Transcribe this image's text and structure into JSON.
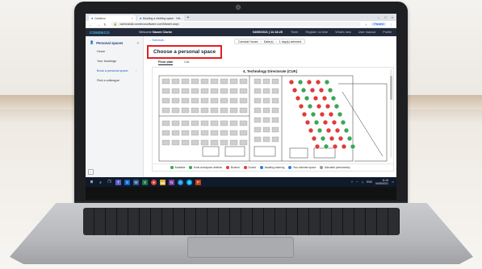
{
  "browser": {
    "tabs": [
      {
        "label": "Condeco"
      },
      {
        "label": "Booking a meeting space · Hel..."
      }
    ],
    "new_tab": "+",
    "url": "carnivalukl.condecosoftware.com/Master.aspx",
    "paused_label": "Paused"
  },
  "app": {
    "logo": "CONDECO",
    "welcome_prefix": "Welcome",
    "user_name": "Naomi Clarke",
    "datetime": "04/05/2021 | 11:18:25",
    "nav_links": [
      "Timer",
      "Register on time",
      "What's new",
      "User manual",
      "Profile"
    ]
  },
  "sidebar": {
    "heading": "Personal spaces",
    "items": [
      {
        "label": "Home"
      },
      {
        "label": "Your bookings"
      },
      {
        "label": "Book a personal space"
      },
      {
        "label": "Find a colleague"
      }
    ]
  },
  "main": {
    "top_link": "← Schedule...",
    "filter": {
      "location": "Carnival House",
      "sep1": "›",
      "dates": "Date(s)",
      "sep2": "›",
      "selected": "1 day(s) selected"
    },
    "page_title": "Choose a personal space",
    "view_tabs": [
      "Floor plan",
      "List"
    ],
    "floor_title": "4, Technology Directorate (CUK)",
    "legend": [
      {
        "label": "Available",
        "color": "#3aa655"
      },
      {
        "label": "Ends workspace deletion",
        "color": "#3aa655"
      },
      {
        "label": "Booked",
        "color": "#e03a3a"
      },
      {
        "label": "Closed",
        "color": "#e03a3a"
      },
      {
        "label": "Awaiting cleaning",
        "color": "#2b7de0"
      },
      {
        "label": "Your selected space",
        "color": "#2b7de0"
      },
      {
        "label": "Allocated permanently",
        "color": "#999999"
      }
    ]
  },
  "taskbar": {
    "tray_lang": "ENG",
    "time": "11:18",
    "date": "04/05/2021"
  },
  "colors": {
    "app_header": "#232a3b",
    "highlight_box": "#e22021",
    "available": "#3aa655",
    "booked": "#e03a3a"
  }
}
